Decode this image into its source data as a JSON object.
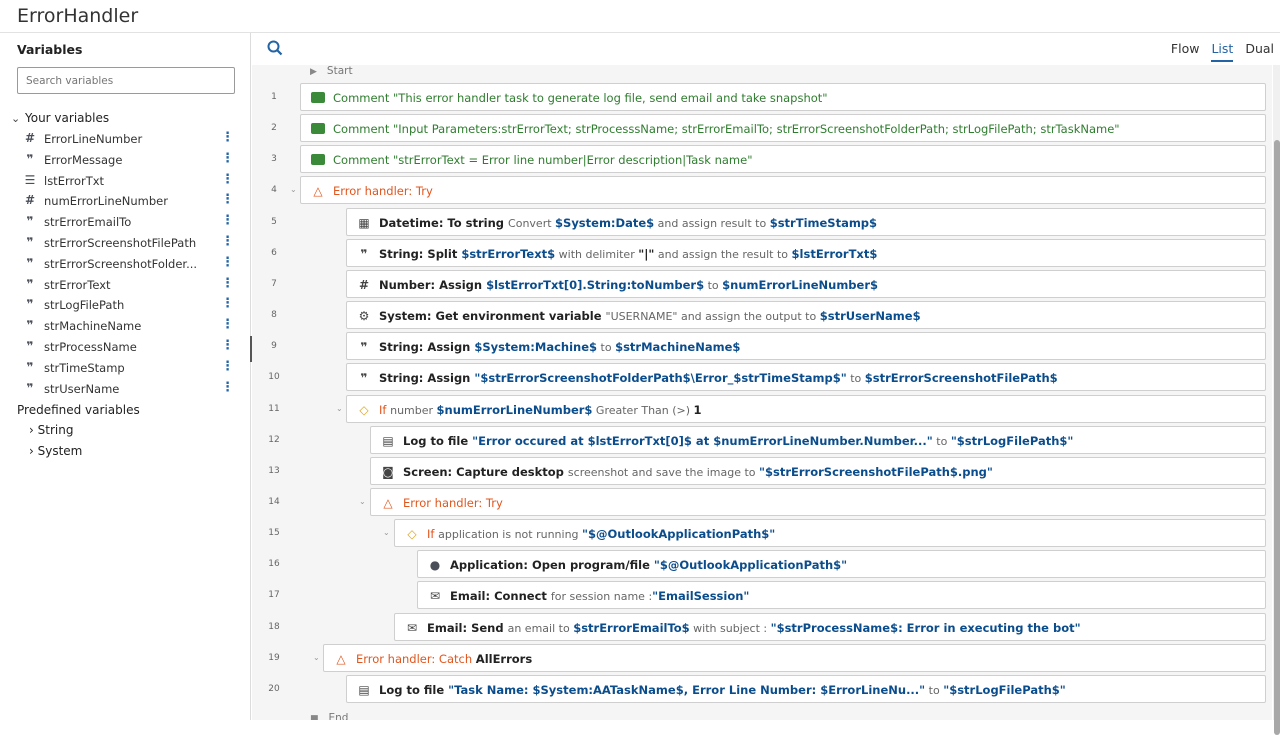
{
  "window": {
    "title": "ErrorHandler"
  },
  "sidebar": {
    "header": "Variables",
    "search_placeholder": "Search variables",
    "your_variables_label": "Your variables",
    "variables": [
      {
        "icon": "#",
        "icon_name": "number-icon",
        "name": "ErrorLineNumber"
      },
      {
        "icon": "❞",
        "icon_name": "string-icon",
        "name": "ErrorMessage"
      },
      {
        "icon": "☰",
        "icon_name": "list-icon",
        "name": "lstErrorTxt"
      },
      {
        "icon": "#",
        "icon_name": "number-icon",
        "name": "numErrorLineNumber"
      },
      {
        "icon": "❞",
        "icon_name": "string-icon",
        "name": "strErrorEmailTo"
      },
      {
        "icon": "❞",
        "icon_name": "string-icon",
        "name": "strErrorScreenshotFilePath"
      },
      {
        "icon": "❞",
        "icon_name": "string-icon",
        "name": "strErrorScreenshotFolder..."
      },
      {
        "icon": "❞",
        "icon_name": "string-icon",
        "name": "strErrorText"
      },
      {
        "icon": "❞",
        "icon_name": "string-icon",
        "name": "strLogFilePath"
      },
      {
        "icon": "❞",
        "icon_name": "string-icon",
        "name": "strMachineName"
      },
      {
        "icon": "❞",
        "icon_name": "string-icon",
        "name": "strProcessName"
      },
      {
        "icon": "❞",
        "icon_name": "string-icon",
        "name": "strTimeStamp"
      },
      {
        "icon": "❞",
        "icon_name": "string-icon",
        "name": "strUserName"
      }
    ],
    "more_glyph": "⋮",
    "predefined_label": "Predefined variables",
    "predefined_groups": [
      "String",
      "System"
    ]
  },
  "toolbar": {
    "views": [
      "Flow",
      "List",
      "Dual"
    ],
    "active_view": "List"
  },
  "flow": {
    "start_label": "Start",
    "end_label": "End",
    "rows": [
      {
        "n": "1",
        "icon": "comment-icon",
        "parts": [
          [
            "c",
            "Comment "
          ],
          [
            "c",
            "\"This error handler task to generate log file, send email and take snapshot\""
          ]
        ]
      },
      {
        "n": "2",
        "icon": "comment-icon",
        "parts": [
          [
            "c",
            "Comment "
          ],
          [
            "c",
            "\"Input Parameters:strErrorText; strProcesssName; strErrorEmailTo; strErrorScreenshotFolderPath; strLogFilePath; strTaskName\""
          ]
        ]
      },
      {
        "n": "3",
        "icon": "comment-icon",
        "parts": [
          [
            "c",
            "Comment "
          ],
          [
            "c",
            "\"strErrorText = Error line number|Error description|Task name\""
          ]
        ]
      },
      {
        "n": "4",
        "icon": "error-handler-icon",
        "parts": [
          [
            "o",
            "Error handler: Try"
          ]
        ]
      },
      {
        "n": "5",
        "icon": "calendar-icon",
        "parts": [
          [
            "k",
            "Datetime: To string "
          ],
          [
            "d",
            "Convert "
          ],
          [
            "v",
            "$System:Date$"
          ],
          [
            "d",
            " and assign result to "
          ],
          [
            "v",
            "$strTimeStamp$"
          ]
        ]
      },
      {
        "n": "6",
        "icon": "string-icon",
        "parts": [
          [
            "k",
            "String: Split "
          ],
          [
            "v",
            "$strErrorText$"
          ],
          [
            "d",
            " with delimiter "
          ],
          [
            "k",
            "\"|\""
          ],
          [
            "d",
            " and assign the result to "
          ],
          [
            "v",
            "$lstErrorTxt$"
          ]
        ]
      },
      {
        "n": "7",
        "icon": "number-icon",
        "parts": [
          [
            "k",
            "Number: Assign "
          ],
          [
            "v",
            "$lstErrorTxt[0].String:toNumber$"
          ],
          [
            "d",
            " to "
          ],
          [
            "v",
            "$numErrorLineNumber$"
          ]
        ]
      },
      {
        "n": "8",
        "icon": "gear-icon",
        "parts": [
          [
            "k",
            "System: Get environment variable "
          ],
          [
            "d",
            "\"USERNAME\" and assign the output to "
          ],
          [
            "v",
            "$strUserName$"
          ]
        ]
      },
      {
        "n": "9",
        "icon": "string-icon",
        "parts": [
          [
            "k",
            "String: Assign "
          ],
          [
            "v",
            "$System:Machine$"
          ],
          [
            "d",
            " to "
          ],
          [
            "v",
            "$strMachineName$"
          ]
        ]
      },
      {
        "n": "10",
        "icon": "string-icon",
        "parts": [
          [
            "k",
            "String: Assign "
          ],
          [
            "v",
            "\"$strErrorScreenshotFolderPath$\\Error_$strTimeStamp$\""
          ],
          [
            "d",
            " to "
          ],
          [
            "v",
            "$strErrorScreenshotFilePath$"
          ]
        ]
      },
      {
        "n": "11",
        "icon": "if-icon",
        "parts": [
          [
            "o",
            "If "
          ],
          [
            "d",
            "number "
          ],
          [
            "v",
            "$numErrorLineNumber$"
          ],
          [
            "d",
            " Greater Than (>) "
          ],
          [
            "k",
            "1"
          ]
        ]
      },
      {
        "n": "12",
        "icon": "log-file-icon",
        "parts": [
          [
            "k",
            "Log to file "
          ],
          [
            "v",
            "\"Error occured at $lstErrorTxt[0]$ at $numErrorLineNumber.Number...\""
          ],
          [
            "d",
            " to "
          ],
          [
            "v",
            "\"$strLogFilePath$\""
          ]
        ]
      },
      {
        "n": "13",
        "icon": "camera-icon",
        "parts": [
          [
            "k",
            "Screen: Capture desktop "
          ],
          [
            "d",
            "screenshot and save the image to "
          ],
          [
            "v",
            "\"$strErrorScreenshotFilePath$.png\""
          ]
        ]
      },
      {
        "n": "14",
        "icon": "error-handler-icon",
        "parts": [
          [
            "o",
            "Error handler: Try"
          ]
        ]
      },
      {
        "n": "15",
        "icon": "if-icon",
        "parts": [
          [
            "o",
            "If "
          ],
          [
            "d",
            "application is not running "
          ],
          [
            "v",
            "\"$@OutlookApplicationPath$\""
          ]
        ]
      },
      {
        "n": "16",
        "icon": "application-icon",
        "parts": [
          [
            "k",
            "Application: Open program/file "
          ],
          [
            "v",
            "\"$@OutlookApplicationPath$\""
          ]
        ]
      },
      {
        "n": "17",
        "icon": "email-icon",
        "parts": [
          [
            "k",
            "Email: Connect "
          ],
          [
            "d",
            "for session name :"
          ],
          [
            "v",
            "\"EmailSession\""
          ]
        ]
      },
      {
        "n": "18",
        "icon": "email-icon",
        "parts": [
          [
            "k",
            "Email: Send "
          ],
          [
            "d",
            "an email to "
          ],
          [
            "v",
            "$strErrorEmailTo$"
          ],
          [
            "d",
            " with subject : "
          ],
          [
            "v",
            "\"$strProcessName$: Error in executing the bot\""
          ]
        ]
      },
      {
        "n": "19",
        "icon": "error-handler-icon",
        "parts": [
          [
            "o",
            "Error handler: Catch "
          ],
          [
            "k",
            "AllErrors"
          ]
        ]
      },
      {
        "n": "20",
        "icon": "log-file-icon",
        "parts": [
          [
            "k",
            "Log to file "
          ],
          [
            "v",
            "\"Task Name: $System:AATaskName$, Error Line Number: $ErrorLineNu...\""
          ],
          [
            "d",
            " to "
          ],
          [
            "v",
            "\"$strLogFilePath$\""
          ]
        ]
      }
    ]
  }
}
